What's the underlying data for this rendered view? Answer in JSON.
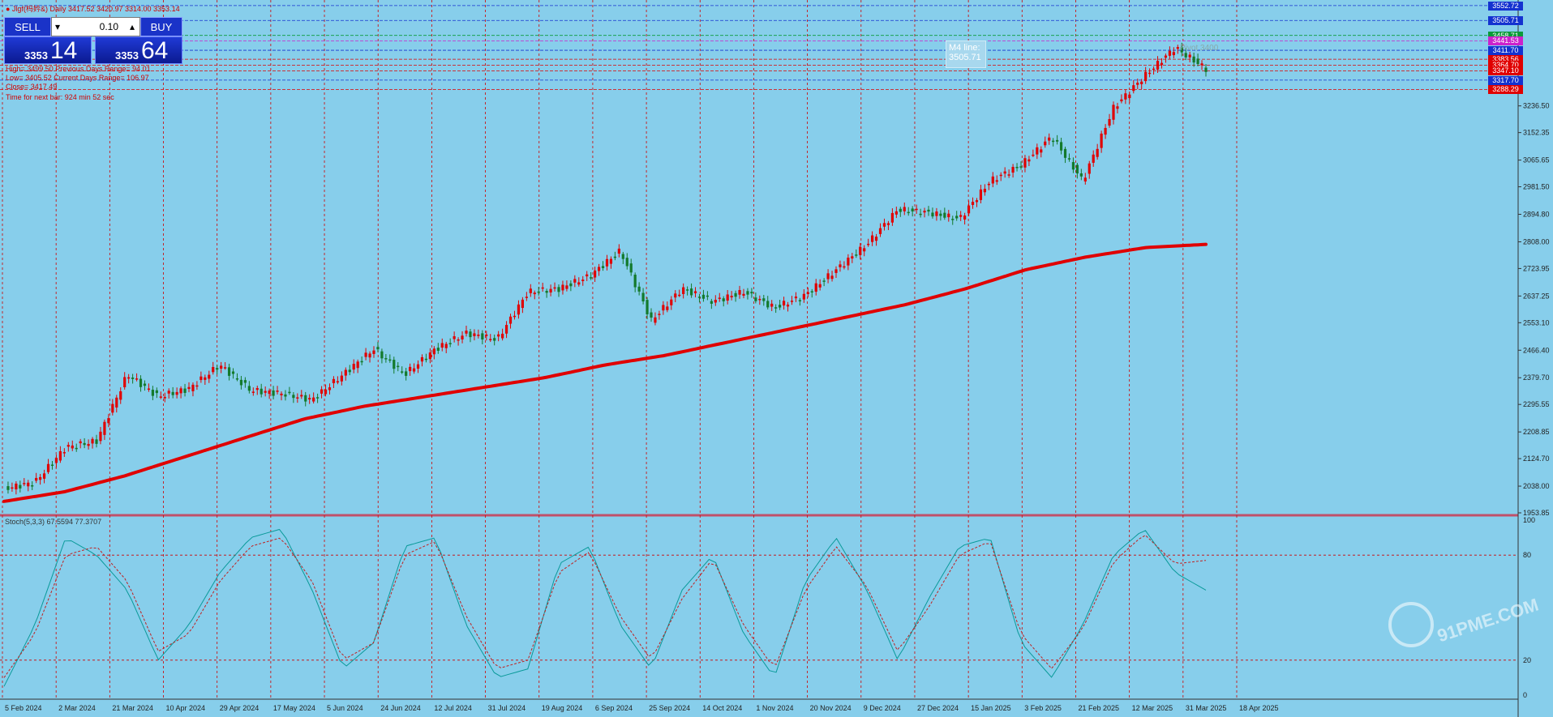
{
  "header": {
    "symbol_line": "● Jlgf(杩妗&) Daily 3417.52 3420.97 3314.00 3353.14",
    "high_line": "High= 3499.50    Previous Days Range= 94.01",
    "low_line": "Low= 3405.52    Current Days Range= 106.97",
    "close_line": "Close= 3417.49",
    "timer_line": "Time for next bar: 924 min 52 sec"
  },
  "trade_panel": {
    "sell_label": "SELL",
    "buy_label": "BUY",
    "lot_value": "0.10",
    "sell_small": "3353",
    "sell_big": "14",
    "buy_small": "3353",
    "buy_big": "64"
  },
  "annotation": {
    "m4_label": "M4 line:",
    "m4_value": "3505.71",
    "pivot_label": "Pivot 3400"
  },
  "price_tags": [
    {
      "label": "3552.72",
      "color": "#1432d0"
    },
    {
      "label": "3505.71",
      "color": "#1432d0"
    },
    {
      "label": "3458.71",
      "color": "#0a9a3a"
    },
    {
      "label": "3441.53",
      "color": "#cc22cc"
    },
    {
      "label": "3411.70",
      "color": "#1432d0"
    },
    {
      "label": "3383.56",
      "color": "#e00000"
    },
    {
      "label": "3364.70",
      "color": "#e00000"
    },
    {
      "label": "3347.10",
      "color": "#e00000"
    },
    {
      "label": "3317.70",
      "color": "#1432d0"
    },
    {
      "label": "3288.29",
      "color": "#e00000"
    }
  ],
  "stoch": {
    "label": "Stoch(5,3,3) 67.5594 77.3707",
    "levels": [
      "100",
      "80",
      "20",
      "0"
    ]
  },
  "watermark": "91PME.COM",
  "chart_data": {
    "type": "candlestick",
    "ylim": [
      1953.85,
      3560
    ],
    "y_ticks": [
      "3236.50",
      "3152.35",
      "3065.65",
      "2981.50",
      "2894.80",
      "2808.00",
      "2723.95",
      "2637.25",
      "2553.10",
      "2466.40",
      "2379.70",
      "2295.55",
      "2208.85",
      "2124.70",
      "2038.00",
      "1953.85"
    ],
    "x_ticks": [
      "5 Feb 2024",
      "2 Mar 2024",
      "21 Mar 2024",
      "10 Apr 2024",
      "29 Apr 2024",
      "17 May 2024",
      "5 Jun 2024",
      "24 Jun 2024",
      "12 Jul 2024",
      "31 Jul 2024",
      "19 Aug 2024",
      "6 Sep 2024",
      "25 Sep 2024",
      "14 Oct 2024",
      "1 Nov 2024",
      "20 Nov 2024",
      "9 Dec 2024",
      "27 Dec 2024",
      "15 Jan 2025",
      "3 Feb 2025",
      "21 Feb 2025",
      "12 Mar 2025",
      "31 Mar 2025",
      "18 Apr 2025"
    ],
    "price_anchors": [
      2030,
      2050,
      2160,
      2180,
      2390,
      2320,
      2345,
      2420,
      2340,
      2330,
      2310,
      2390,
      2470,
      2390,
      2470,
      2520,
      2500,
      2650,
      2660,
      2700,
      2780,
      2560,
      2660,
      2620,
      2650,
      2600,
      2640,
      2720,
      2800,
      2910,
      2900,
      2880,
      3000,
      3050,
      3140,
      3000,
      3230,
      3330,
      3420,
      3353
    ],
    "ema_anchors": [
      1990,
      2020,
      2070,
      2130,
      2190,
      2250,
      2290,
      2320,
      2350,
      2380,
      2420,
      2450,
      2490,
      2530,
      2570,
      2610,
      2660,
      2720,
      2760,
      2790,
      2800
    ],
    "series": [
      {
        "name": "price",
        "color": "#137a2c"
      },
      {
        "name": "ema",
        "color": "#e00000"
      }
    ],
    "stoch_k_anchors": [
      5,
      40,
      90,
      80,
      60,
      20,
      40,
      70,
      90,
      95,
      60,
      15,
      30,
      85,
      90,
      40,
      10,
      15,
      75,
      85,
      40,
      15,
      60,
      80,
      35,
      10,
      65,
      90,
      60,
      20,
      55,
      85,
      90,
      30,
      10,
      40,
      80,
      95,
      70,
      60
    ],
    "stoch_d_anchors": [
      10,
      35,
      80,
      85,
      65,
      25,
      35,
      65,
      85,
      90,
      65,
      20,
      30,
      80,
      88,
      45,
      15,
      20,
      70,
      82,
      45,
      20,
      55,
      78,
      40,
      15,
      60,
      85,
      62,
      25,
      50,
      80,
      88,
      35,
      15,
      38,
      76,
      92,
      75,
      77
    ]
  }
}
